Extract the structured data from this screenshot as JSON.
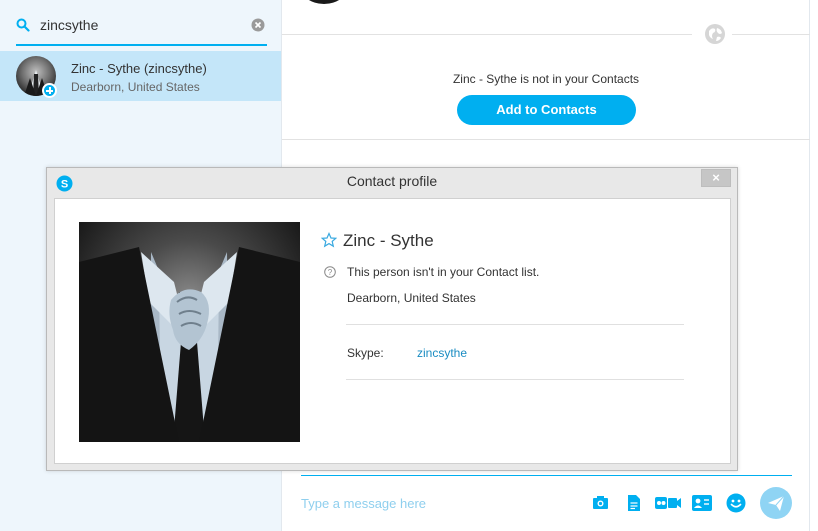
{
  "search": {
    "value": "zincsythe"
  },
  "result": {
    "name": "Zinc - Sythe (zincsythe)",
    "location": "Dearborn, United States"
  },
  "main": {
    "not_in_contacts": "Zinc - Sythe is not in your Contacts",
    "add_button": "Add to Contacts"
  },
  "compose": {
    "placeholder": "Type a message here"
  },
  "dialog": {
    "title": "Contact profile",
    "close": "×",
    "name": "Zinc - Sythe",
    "note": "This person isn't in your Contact list.",
    "location": "Dearborn, United States",
    "skype_label": "Skype:",
    "skype_value": "zincsythe"
  },
  "colors": {
    "accent": "#00aff0",
    "selected_row": "#c4e6f9",
    "link": "#1a8cc2"
  }
}
